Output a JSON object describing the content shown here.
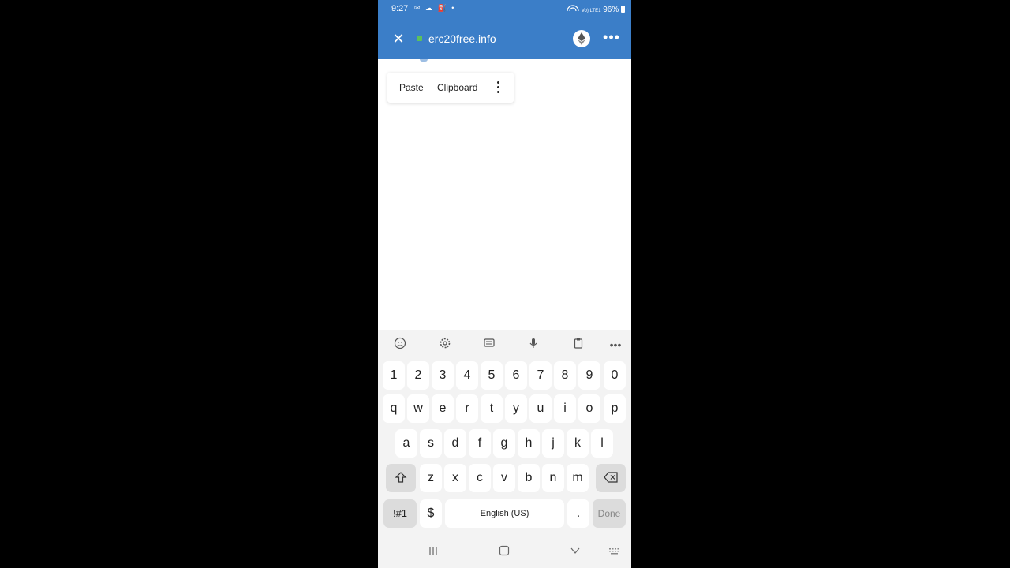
{
  "status_bar": {
    "time": "9:27",
    "notif_icons": "✉ ☁ ⛽ •",
    "right_text": "96%",
    "network": "Vo) LTE1"
  },
  "browser": {
    "url": "erc20free.info",
    "close_icon": "close-icon",
    "more_icon": "more-horizontal-icon",
    "site_icon": "ethereum-icon",
    "accent_color": "#3b7ec8"
  },
  "context_menu": {
    "items": [
      "Paste",
      "Clipboard"
    ],
    "more_icon": "more-vertical-icon"
  },
  "keyboard": {
    "toolbar_icons": [
      "emoji-icon",
      "settings-icon",
      "text-edit-icon",
      "microphone-icon",
      "clipboard-icon",
      "more-horizontal-icon"
    ],
    "number_row": [
      "1",
      "2",
      "3",
      "4",
      "5",
      "6",
      "7",
      "8",
      "9",
      "0"
    ],
    "row1": [
      "q",
      "w",
      "e",
      "r",
      "t",
      "y",
      "u",
      "i",
      "o",
      "p"
    ],
    "row2": [
      "a",
      "s",
      "d",
      "f",
      "g",
      "h",
      "j",
      "k",
      "l"
    ],
    "row3": [
      "z",
      "x",
      "c",
      "v",
      "b",
      "n",
      "m"
    ],
    "symbols_label": "!#1",
    "dollar_label": "$",
    "space_label": "English (US)",
    "period_label": ".",
    "done_label": "Done"
  },
  "nav_bar": {
    "icons": [
      "recent-apps-icon",
      "home-icon",
      "back-icon",
      "keyboard-icon"
    ]
  }
}
